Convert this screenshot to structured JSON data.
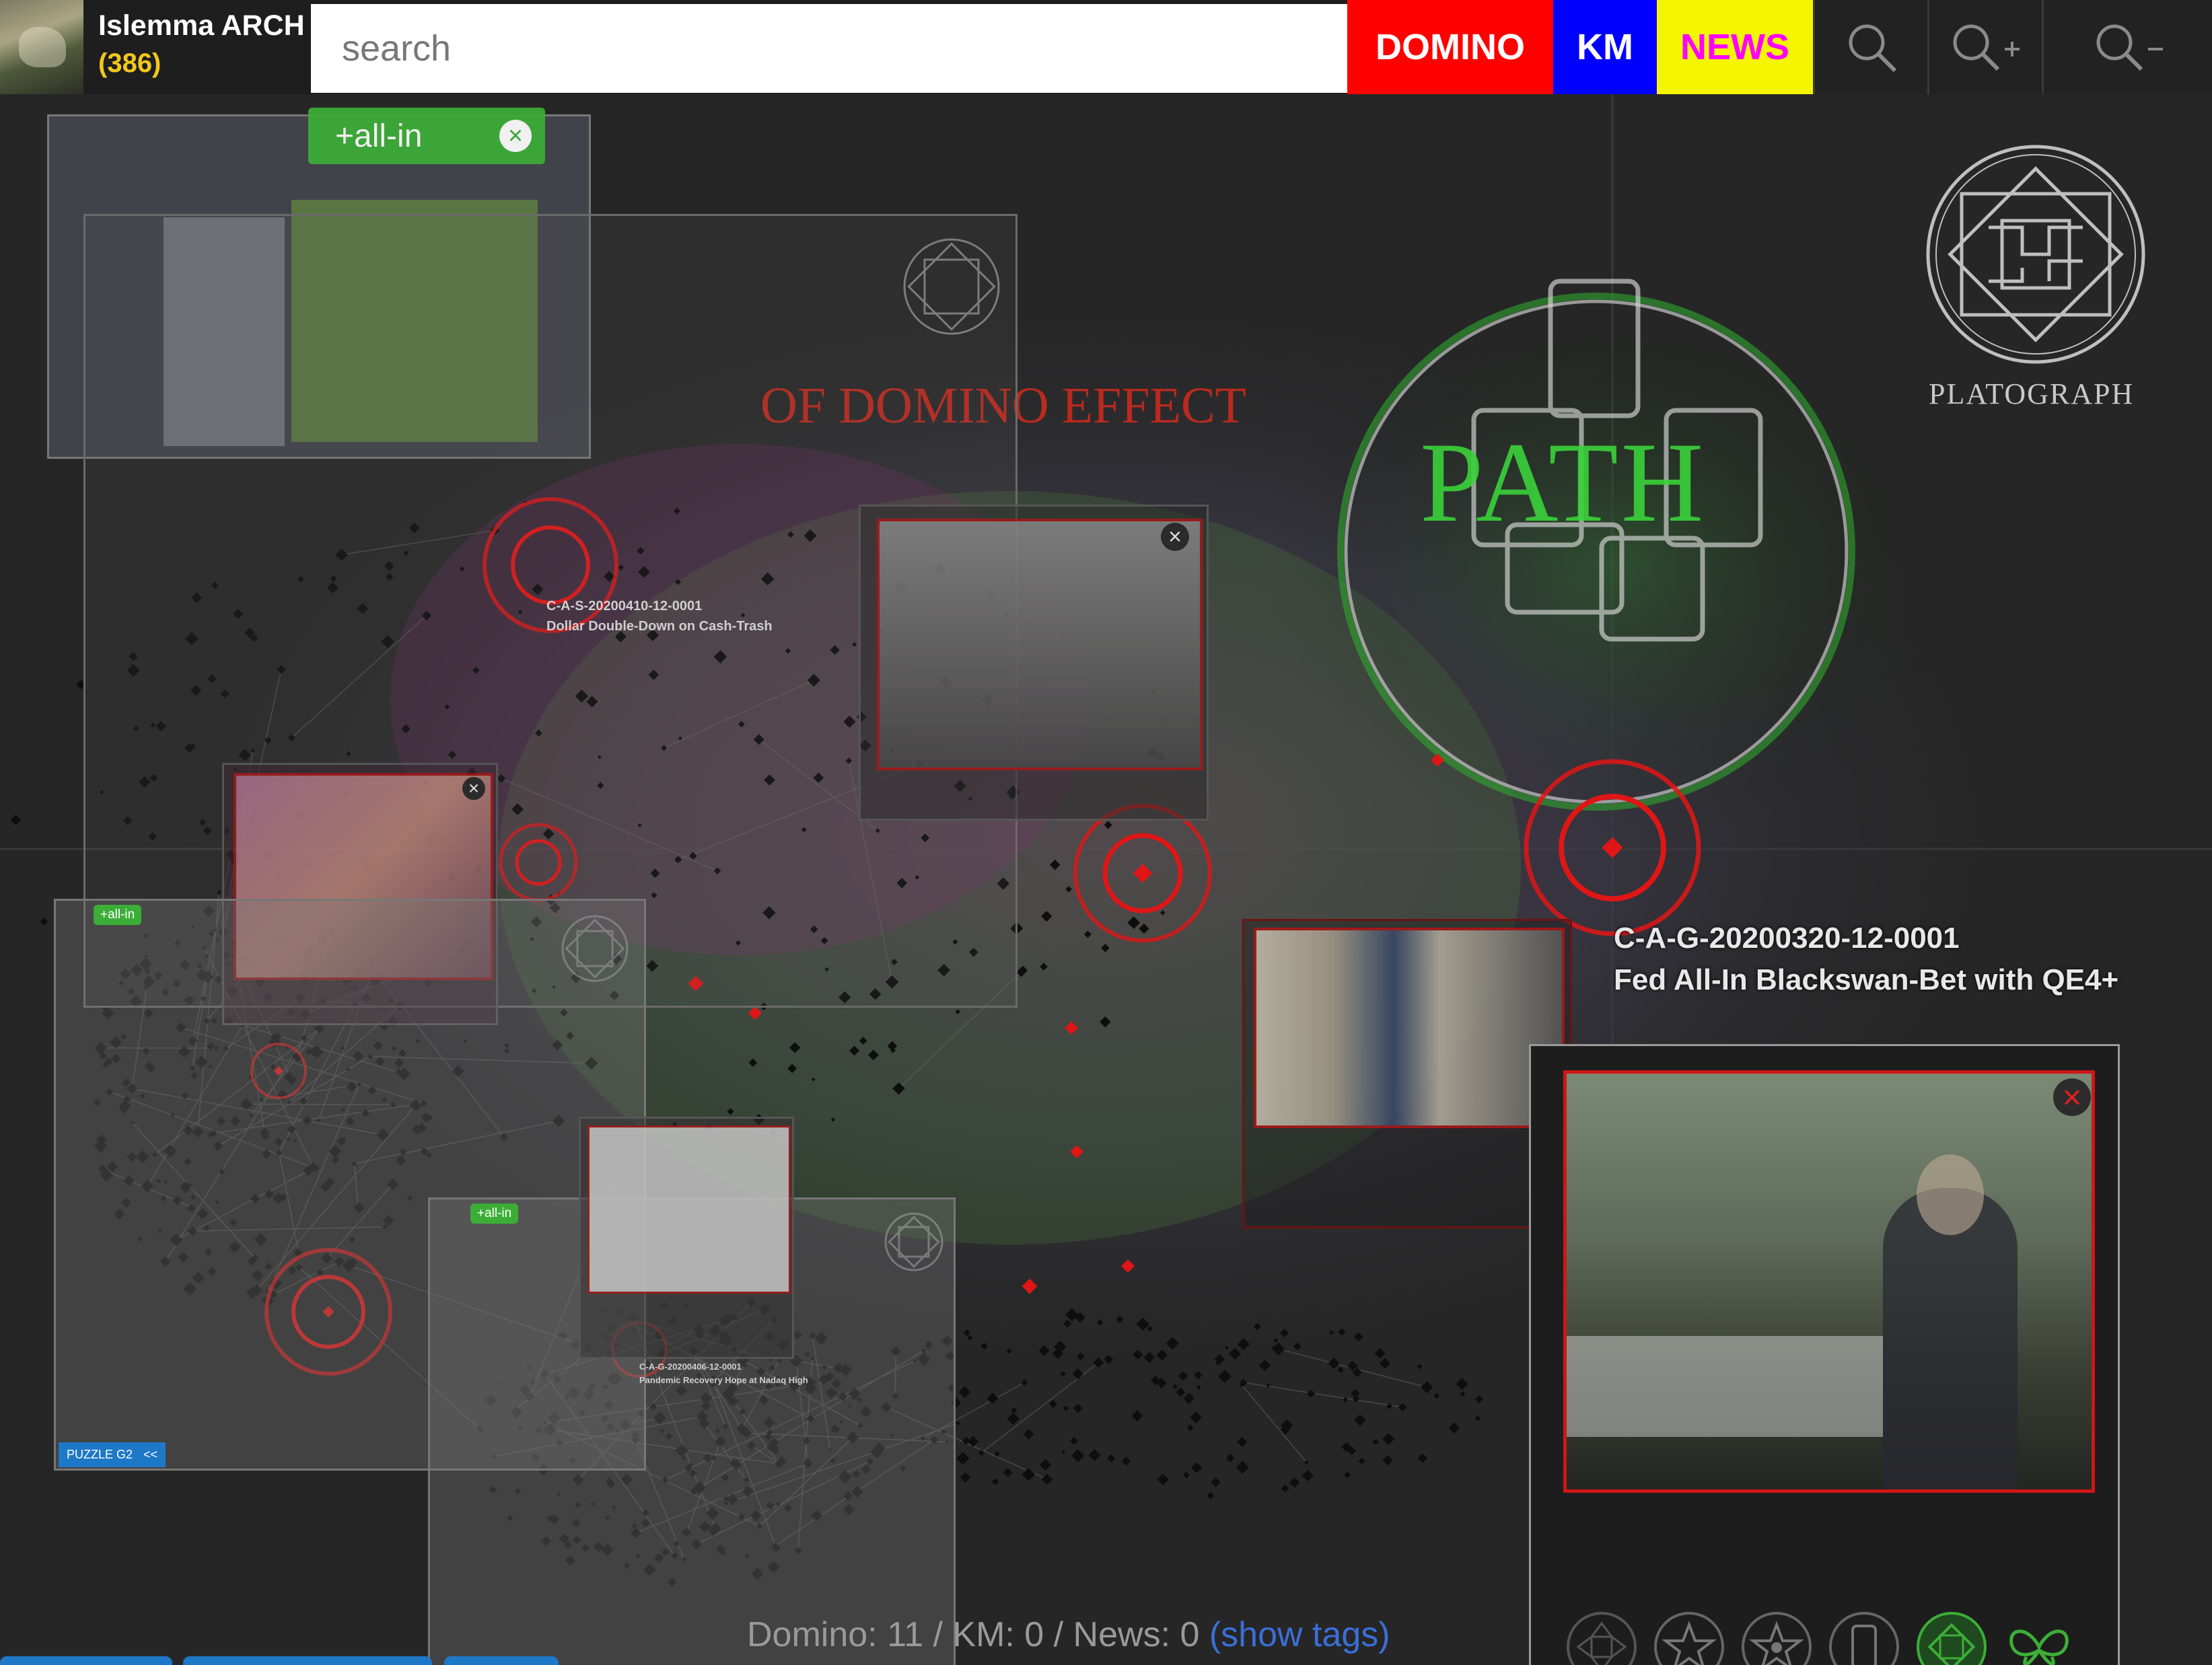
{
  "user": {
    "name": "Islemma ARCH",
    "count": "(386)"
  },
  "search": {
    "placeholder": "search"
  },
  "categories": {
    "domino": "DOMINO",
    "km": "KM",
    "news": "NEWS"
  },
  "icons": {
    "search": "search-icon",
    "zoom_in": "zoom-in-icon",
    "zoom_out": "zoom-out-icon"
  },
  "filter_tag": {
    "label": "+all-in"
  },
  "overlay_titles": {
    "path": "PATH",
    "domino_effect": "OF DOMINO EFFECT",
    "logo": "PLATOGRAPH"
  },
  "main_node": {
    "id": "C-A-G-20200320-12-0001",
    "title": "Fed All-In Blackswan-Bet with QE4+"
  },
  "minor_nodes": [
    {
      "id": "C-A-S-20200410-12-0001",
      "title": "Dollar Double-Down on Cash-Trash"
    },
    {
      "id": "C-A-G-20200406-12-0001",
      "title": "Pandemic Recovery Hope at Nadaq High"
    }
  ],
  "mini_panel": {
    "tag": "+all-in",
    "button": "PUZZLE G2",
    "back": "<<"
  },
  "footer": {
    "counts": "Domino: 11 / KM: 0 / News: 0",
    "show_tags": "(show tags)"
  },
  "colors": {
    "domino": "#ff0000",
    "km": "#0000ff",
    "news": "#f5f500",
    "accent_green": "#3cae37"
  }
}
